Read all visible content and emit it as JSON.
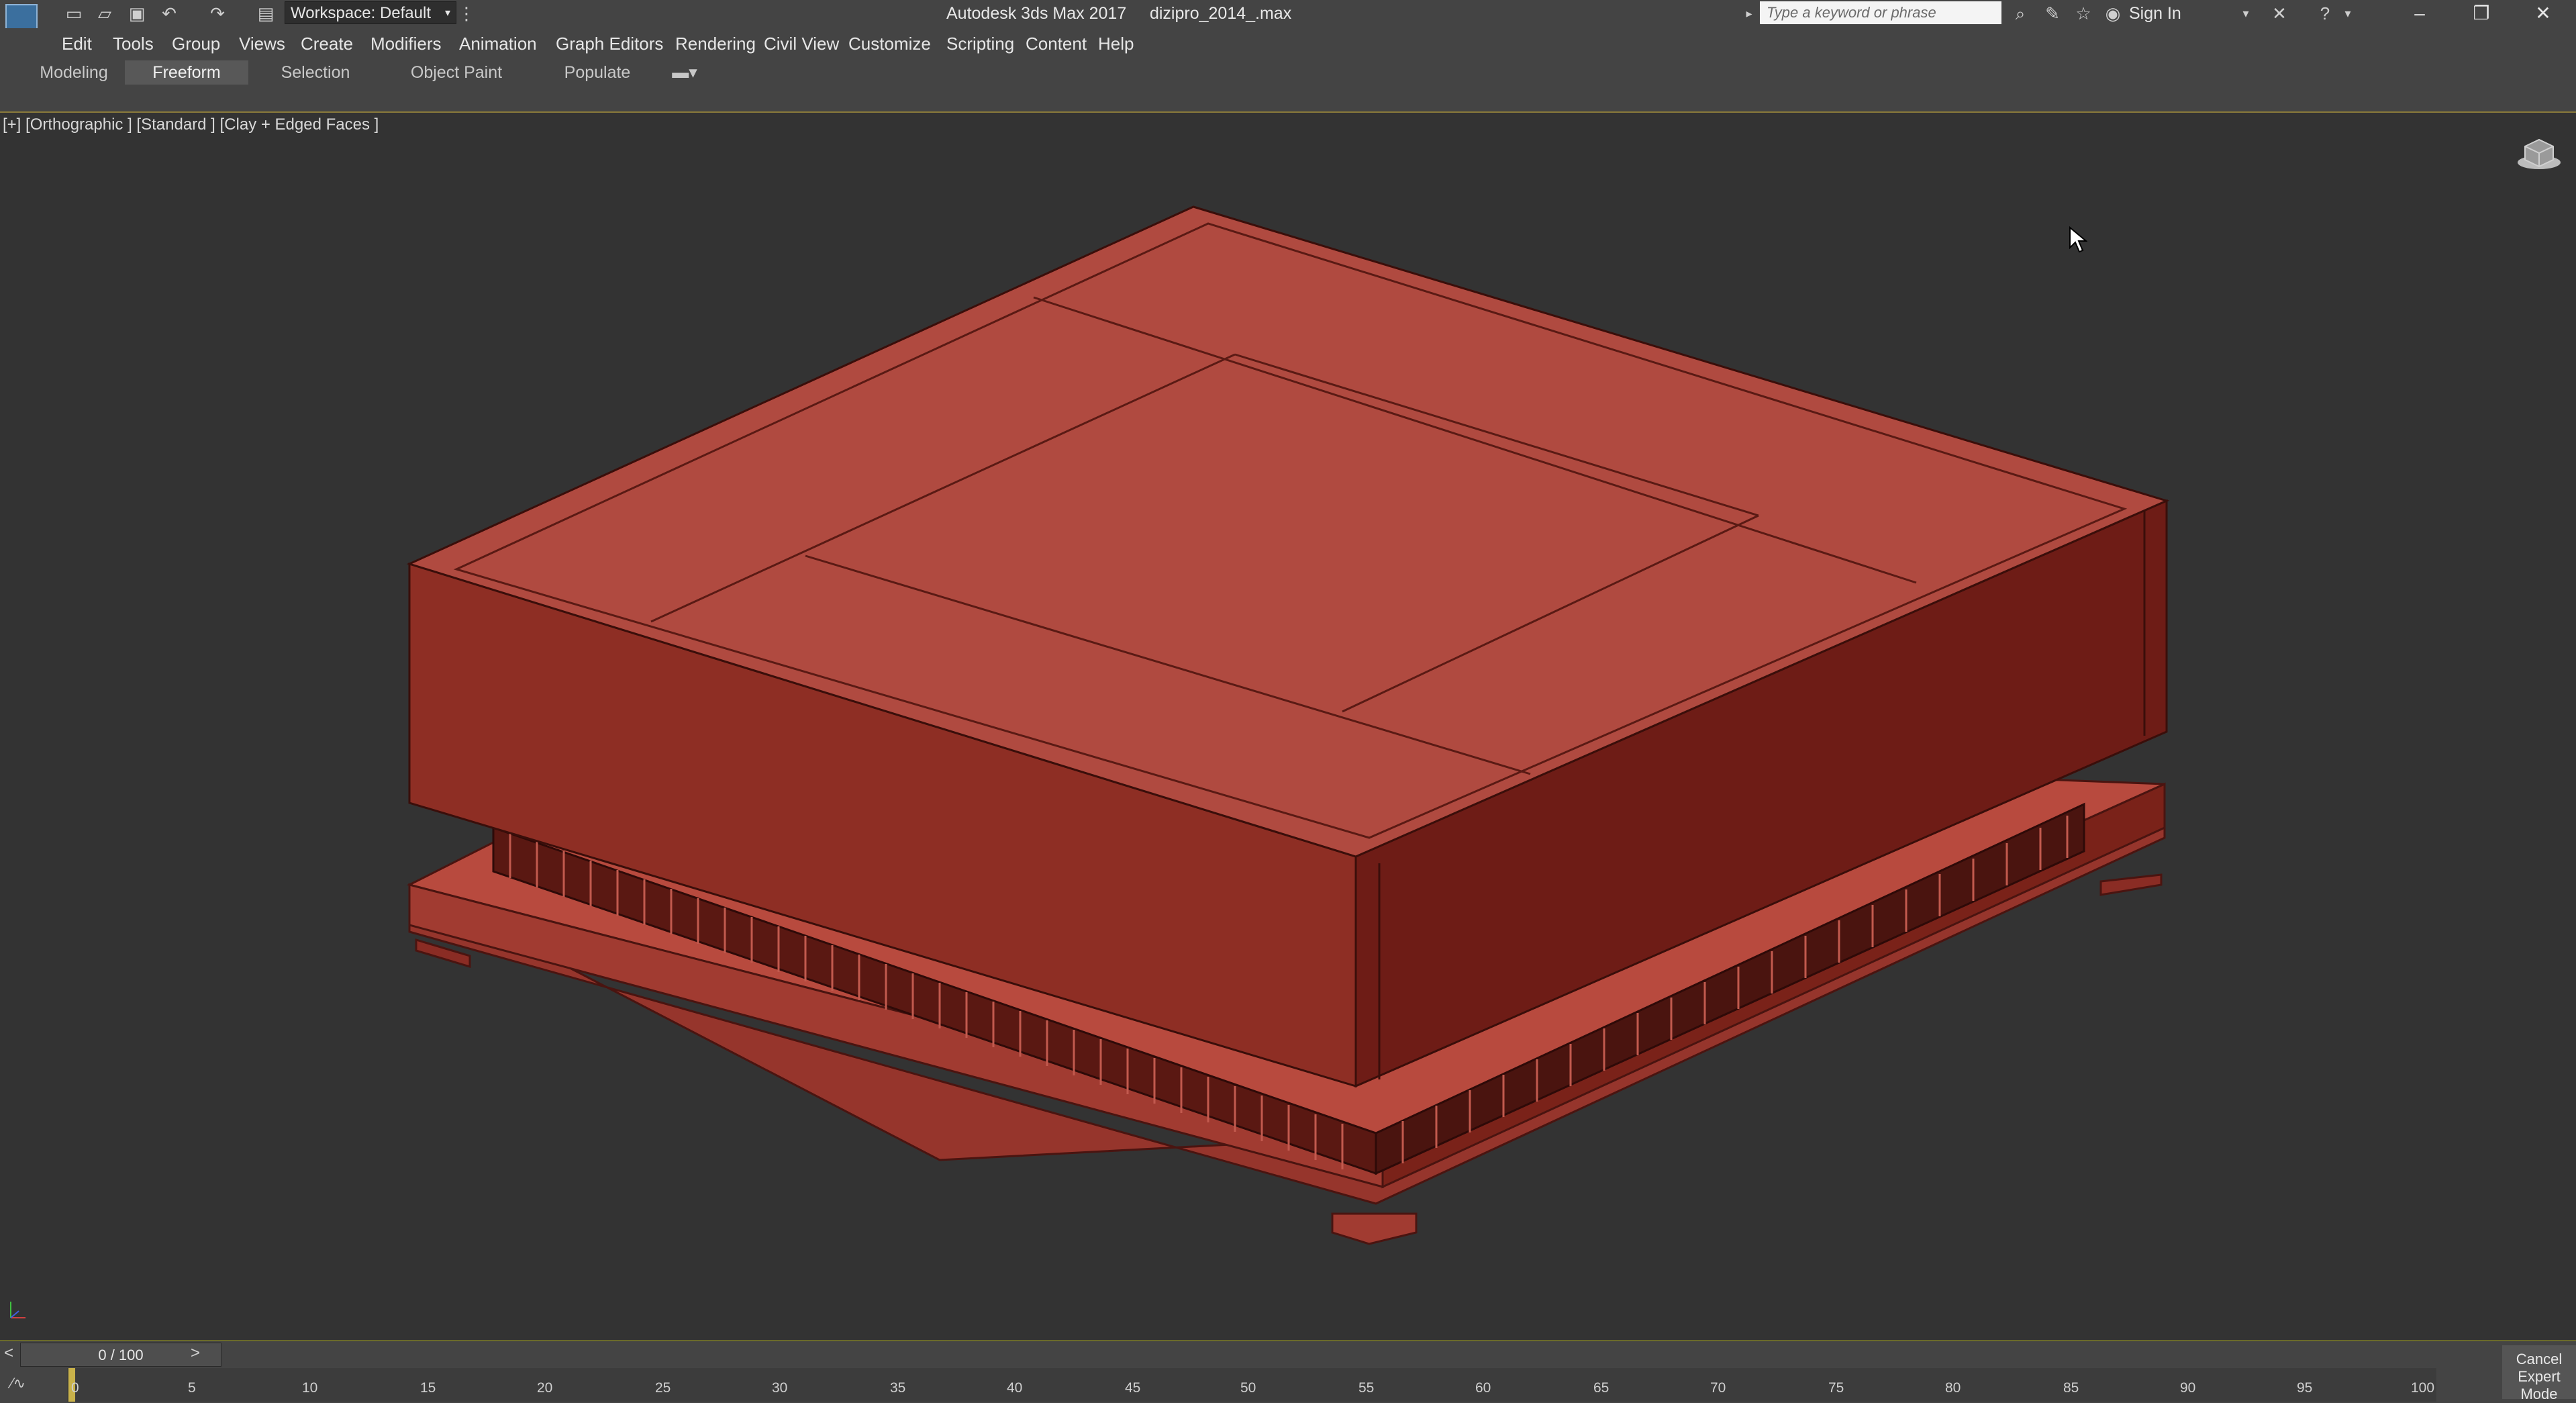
{
  "titlebar": {
    "workspace_label": "Workspace: Default",
    "app_name": "Autodesk 3ds Max 2017",
    "file_name": "dizipro_2014_.max",
    "search_placeholder": "Type a keyword or phrase",
    "sign_in": "Sign In"
  },
  "menu": [
    "Edit",
    "Tools",
    "Group",
    "Views",
    "Create",
    "Modifiers",
    "Animation",
    "Graph Editors",
    "Rendering",
    "Civil View",
    "Customize",
    "Scripting",
    "Content",
    "Help"
  ],
  "ribbon_tabs": [
    "Modeling",
    "Freeform",
    "Selection",
    "Object Paint",
    "Populate"
  ],
  "ribbon_active": "Freeform",
  "viewport": {
    "label": "[+] [Orthographic ] [Standard ] [Clay + Edged Faces ]",
    "model_color": "#b04a40"
  },
  "timeline": {
    "frame_display": "0 / 100",
    "prev": "<",
    "next": ">",
    "ticks": [
      "0",
      "5",
      "10",
      "15",
      "20",
      "25",
      "30",
      "35",
      "40",
      "45",
      "50",
      "55",
      "60",
      "65",
      "70",
      "75",
      "80",
      "85",
      "90",
      "95",
      "100"
    ],
    "cancel_line1": "Cancel",
    "cancel_line2": "Expert Mode"
  }
}
